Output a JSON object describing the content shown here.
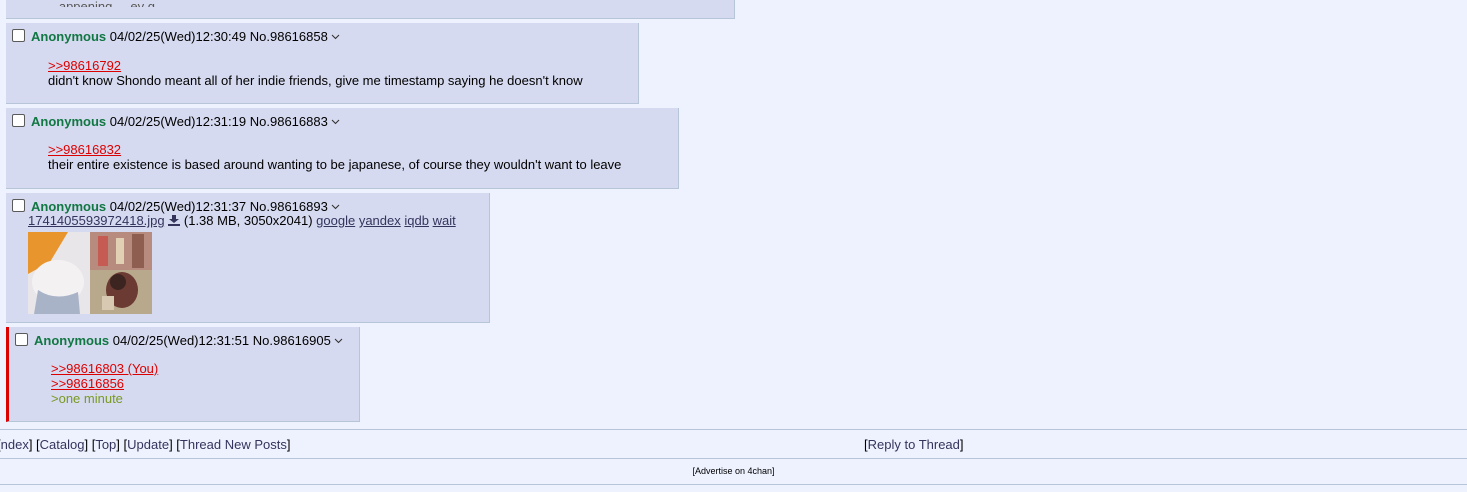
{
  "top_post": {
    "partial_text": "...appening, ...ey g..."
  },
  "posts": [
    {
      "name": "Anonymous",
      "datetime": "04/02/25(Wed)12:30:49",
      "number": "No.98616858",
      "quote": ">>98616792",
      "text": "didn't know Shondo meant all of her indie friends, give me timestamp saying he doesn't know"
    },
    {
      "name": "Anonymous",
      "datetime": "04/02/25(Wed)12:31:19",
      "number": "No.98616883",
      "quote": ">>98616832",
      "text": "their entire existence is based around wanting to be japanese, of course they wouldn't want to leave"
    },
    {
      "name": "Anonymous",
      "datetime": "04/02/25(Wed)12:31:37",
      "number": "No.98616893",
      "file": {
        "filename": "1741405593972418.jpg",
        "meta": "(1.38 MB, 3050x2041)",
        "search_links": [
          "google",
          "yandex",
          "iqdb",
          "wait"
        ]
      }
    },
    {
      "name": "Anonymous",
      "datetime": "04/02/25(Wed)12:31:51",
      "number": "No.98616905",
      "quotes": [
        ">>98616803 (You)",
        ">>98616856"
      ],
      "greentext": ">one minute"
    }
  ],
  "nav": {
    "index": "ndex",
    "catalog": "Catalog",
    "top": "Top",
    "update": "Update",
    "thread_new_posts": "Thread New Posts",
    "reply_to_thread": "Reply to Thread"
  },
  "ad": {
    "label": "[Advertise on 4chan]"
  },
  "colors": {
    "background": "#eef2ff",
    "post_bg": "#d6daf0",
    "name": "#117743",
    "quotelink": "#dd0000",
    "greentext": "#789922",
    "link": "#34345c",
    "you_border": "#dd0000"
  },
  "icons": [
    "checkbox",
    "chevron-down-icon",
    "download-icon"
  ]
}
